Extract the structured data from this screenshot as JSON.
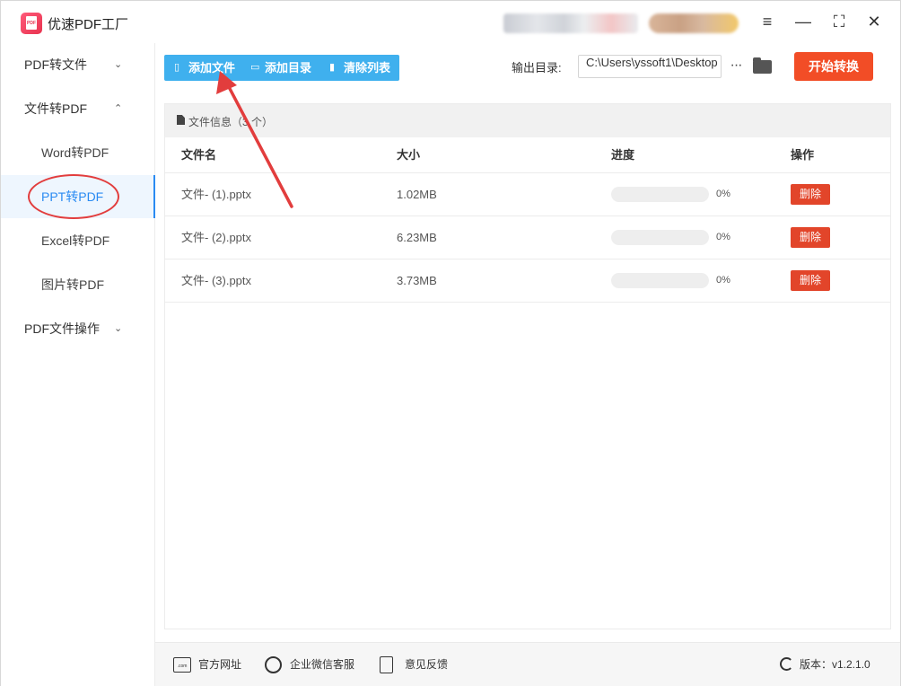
{
  "app": {
    "title": "优速PDF工厂"
  },
  "window_controls": {
    "menu": "≡",
    "minimize": "—",
    "maximize": "⛶",
    "close": "✕"
  },
  "sidebar": {
    "groups": [
      {
        "label": "PDF转文件",
        "chevron": "⌄"
      },
      {
        "label": "文件转PDF",
        "chevron": "⌃"
      },
      {
        "label": "PDF文件操作",
        "chevron": "⌄"
      }
    ],
    "items": [
      {
        "label": "Word转PDF"
      },
      {
        "label": "PPT转PDF"
      },
      {
        "label": "Excel转PDF"
      },
      {
        "label": "图片转PDF"
      }
    ]
  },
  "toolbar": {
    "add_file": "添加文件",
    "add_folder": "添加目录",
    "clear_list": "清除列表",
    "output_label": "输出目录:",
    "output_path": "C:\\Users\\yssoft1\\Desktop",
    "more": "···",
    "start": "开始转换"
  },
  "panel": {
    "title": "文件信息（3 个）",
    "columns": {
      "name": "文件名",
      "size": "大小",
      "progress": "进度",
      "action": "操作"
    },
    "rows": [
      {
        "name": "文件- (1).pptx",
        "size": "1.02MB",
        "progress": 0,
        "progress_label": "0%",
        "action": "删除"
      },
      {
        "name": "文件- (2).pptx",
        "size": "6.23MB",
        "progress": 0,
        "progress_label": "0%",
        "action": "删除"
      },
      {
        "name": "文件- (3).pptx",
        "size": "3.73MB",
        "progress": 0,
        "progress_label": "0%",
        "action": "删除"
      }
    ]
  },
  "footer": {
    "site_icon_text": ".com",
    "site": "官方网址",
    "wechat": "企业微信客服",
    "feedback": "意见反馈",
    "version": "版本：v1.2.1.0"
  },
  "colors": {
    "accent": "#3fb0ee",
    "active": "#2a8bf2",
    "start": "#f24d26",
    "delete": "#e2452a",
    "annotation": "#e23d3d"
  }
}
